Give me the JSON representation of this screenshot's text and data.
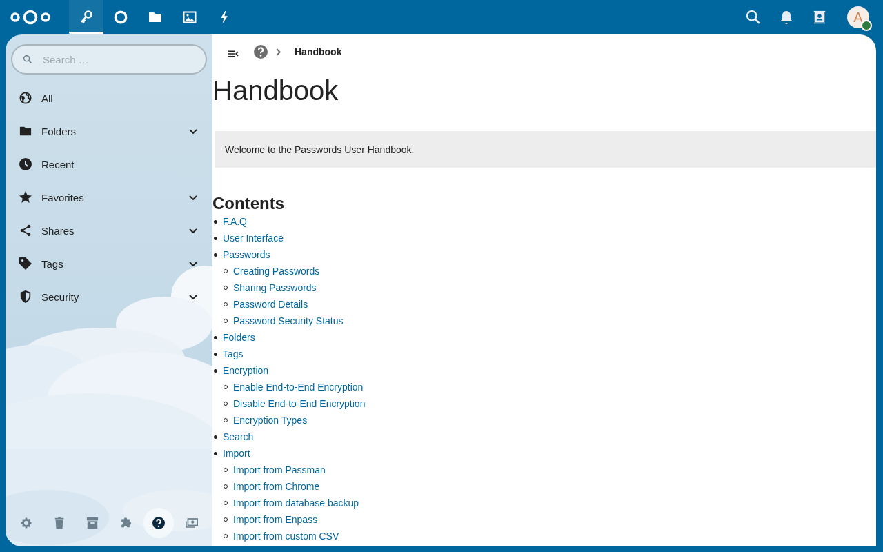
{
  "header": {
    "apps": [
      {
        "selected": true
      },
      {
        "selected": false
      },
      {
        "selected": false
      },
      {
        "selected": false
      },
      {
        "selected": false
      }
    ],
    "avatar": {
      "initial": "A",
      "status": {
        "color": "#2d7b41"
      }
    }
  },
  "sidebar": {
    "search": {
      "placeholder": "Search …"
    },
    "items": [
      {
        "label": "All",
        "kind": "link"
      },
      {
        "label": "Folders",
        "kind": "group"
      },
      {
        "label": "Recent",
        "kind": "link"
      },
      {
        "label": "Favorites",
        "kind": "group"
      },
      {
        "label": "Shares",
        "kind": "group"
      },
      {
        "label": "Tags",
        "kind": "group"
      },
      {
        "label": "Security",
        "kind": "group"
      }
    ],
    "footer": [
      {
        "selected": false
      },
      {
        "selected": false
      },
      {
        "selected": false
      },
      {
        "selected": false
      },
      {
        "selected": true
      },
      {
        "selected": false
      }
    ]
  },
  "main": {
    "breadcrumb": [
      "Handbook"
    ],
    "title": "Handbook",
    "notice": "Welcome to the Passwords User Handbook.",
    "contents_heading": "Contents",
    "toc": [
      {
        "label": "F.A.Q"
      },
      {
        "label": "User Interface"
      },
      {
        "label": "Passwords",
        "children": [
          {
            "label": "Creating Passwords"
          },
          {
            "label": "Sharing Passwords"
          },
          {
            "label": "Password Details"
          },
          {
            "label": "Password Security Status"
          }
        ]
      },
      {
        "label": "Folders"
      },
      {
        "label": "Tags"
      },
      {
        "label": "Encryption",
        "children": [
          {
            "label": "Enable End-to-End Encryption"
          },
          {
            "label": "Disable End-to-End Encryption"
          },
          {
            "label": "Encryption Types"
          }
        ]
      },
      {
        "label": "Search"
      },
      {
        "label": "Import",
        "children": [
          {
            "label": "Import from Passman"
          },
          {
            "label": "Import from Chrome"
          },
          {
            "label": "Import from database backup"
          },
          {
            "label": "Import from Enpass"
          },
          {
            "label": "Import from custom CSV"
          }
        ]
      }
    ]
  }
}
